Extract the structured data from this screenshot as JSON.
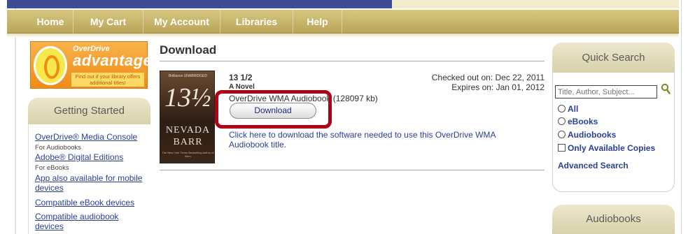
{
  "nav": {
    "items": [
      {
        "label": "Home"
      },
      {
        "label": "My Cart"
      },
      {
        "label": "My Account"
      },
      {
        "label": "Libraries"
      },
      {
        "label": "Help"
      }
    ]
  },
  "ad": {
    "brand": "OverDrive",
    "title": "advantage",
    "tagline": "Find out if your library offers additional titles!"
  },
  "getting_started": {
    "heading": "Getting Started",
    "links": [
      {
        "label": "OverDrive® Media Console",
        "sub": "For Audiobooks"
      },
      {
        "label": "Adobe® Digital Editions",
        "sub": "For eBooks"
      },
      {
        "label": "App also available for mobile devices"
      },
      {
        "label": "Compatible eBook devices"
      },
      {
        "label": "Compatible audiobook devices"
      }
    ]
  },
  "download": {
    "heading": "Download",
    "book": {
      "title": "13 1/2",
      "subtitle": "A Novel",
      "format": "OverDrive WMA Audiobook (128097 kb)",
      "checked_out": "Checked out on:  Dec 22, 2011",
      "expires": "Expires on:  Jan 01, 2012",
      "download_label": "Download",
      "help_text": "Click here to download the software needed to use this OverDrive WMA Audiobook title."
    },
    "cover": {
      "badge": "Brilliance UNABRIDGED",
      "number": "13½",
      "author_first": "NEVADA",
      "author_last": "BARR",
      "blurb": "The New York Times Bestselling Author of Burn"
    },
    "highlight_color": "#b00016"
  },
  "quick_search": {
    "heading": "Quick Search",
    "placeholder": "Title, Author, Subject...",
    "options": [
      {
        "label": "All",
        "type": "radio"
      },
      {
        "label": "eBooks",
        "type": "radio"
      },
      {
        "label": "Audiobooks",
        "type": "radio"
      },
      {
        "label": "Only Available Copies",
        "type": "checkbox"
      }
    ],
    "advanced": "Advanced Search"
  },
  "audiobooks": {
    "heading": "Audiobooks"
  },
  "colors": {
    "nav_gold": "#c9b66b",
    "link_blue": "#2a3f9a",
    "top_blue": "#3d4d94"
  }
}
